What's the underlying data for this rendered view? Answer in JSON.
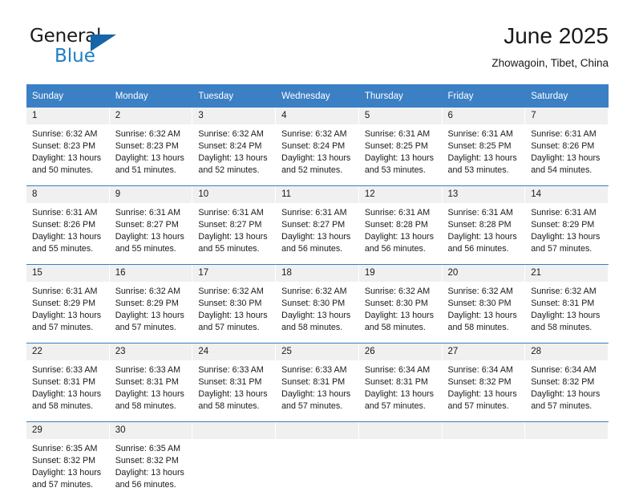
{
  "brand": {
    "name_top": "General",
    "name_bottom": "Blue",
    "accent_color": "#1d7ec4",
    "triangle_color": "#1565a8"
  },
  "header": {
    "title": "June 2025",
    "subtitle": "Zhowagoin, Tibet, China"
  },
  "theme": {
    "header_bg": "#3b7fc4",
    "daynum_bg": "#f0f0f0",
    "text": "#1a1a1a"
  },
  "weekday_headers": [
    "Sunday",
    "Monday",
    "Tuesday",
    "Wednesday",
    "Thursday",
    "Friday",
    "Saturday"
  ],
  "weeks": [
    [
      {
        "day": "1",
        "sunrise": "Sunrise: 6:32 AM",
        "sunset": "Sunset: 8:23 PM",
        "daylight": "Daylight: 13 hours and 50 minutes."
      },
      {
        "day": "2",
        "sunrise": "Sunrise: 6:32 AM",
        "sunset": "Sunset: 8:23 PM",
        "daylight": "Daylight: 13 hours and 51 minutes."
      },
      {
        "day": "3",
        "sunrise": "Sunrise: 6:32 AM",
        "sunset": "Sunset: 8:24 PM",
        "daylight": "Daylight: 13 hours and 52 minutes."
      },
      {
        "day": "4",
        "sunrise": "Sunrise: 6:32 AM",
        "sunset": "Sunset: 8:24 PM",
        "daylight": "Daylight: 13 hours and 52 minutes."
      },
      {
        "day": "5",
        "sunrise": "Sunrise: 6:31 AM",
        "sunset": "Sunset: 8:25 PM",
        "daylight": "Daylight: 13 hours and 53 minutes."
      },
      {
        "day": "6",
        "sunrise": "Sunrise: 6:31 AM",
        "sunset": "Sunset: 8:25 PM",
        "daylight": "Daylight: 13 hours and 53 minutes."
      },
      {
        "day": "7",
        "sunrise": "Sunrise: 6:31 AM",
        "sunset": "Sunset: 8:26 PM",
        "daylight": "Daylight: 13 hours and 54 minutes."
      }
    ],
    [
      {
        "day": "8",
        "sunrise": "Sunrise: 6:31 AM",
        "sunset": "Sunset: 8:26 PM",
        "daylight": "Daylight: 13 hours and 55 minutes."
      },
      {
        "day": "9",
        "sunrise": "Sunrise: 6:31 AM",
        "sunset": "Sunset: 8:27 PM",
        "daylight": "Daylight: 13 hours and 55 minutes."
      },
      {
        "day": "10",
        "sunrise": "Sunrise: 6:31 AM",
        "sunset": "Sunset: 8:27 PM",
        "daylight": "Daylight: 13 hours and 55 minutes."
      },
      {
        "day": "11",
        "sunrise": "Sunrise: 6:31 AM",
        "sunset": "Sunset: 8:27 PM",
        "daylight": "Daylight: 13 hours and 56 minutes."
      },
      {
        "day": "12",
        "sunrise": "Sunrise: 6:31 AM",
        "sunset": "Sunset: 8:28 PM",
        "daylight": "Daylight: 13 hours and 56 minutes."
      },
      {
        "day": "13",
        "sunrise": "Sunrise: 6:31 AM",
        "sunset": "Sunset: 8:28 PM",
        "daylight": "Daylight: 13 hours and 56 minutes."
      },
      {
        "day": "14",
        "sunrise": "Sunrise: 6:31 AM",
        "sunset": "Sunset: 8:29 PM",
        "daylight": "Daylight: 13 hours and 57 minutes."
      }
    ],
    [
      {
        "day": "15",
        "sunrise": "Sunrise: 6:31 AM",
        "sunset": "Sunset: 8:29 PM",
        "daylight": "Daylight: 13 hours and 57 minutes."
      },
      {
        "day": "16",
        "sunrise": "Sunrise: 6:32 AM",
        "sunset": "Sunset: 8:29 PM",
        "daylight": "Daylight: 13 hours and 57 minutes."
      },
      {
        "day": "17",
        "sunrise": "Sunrise: 6:32 AM",
        "sunset": "Sunset: 8:30 PM",
        "daylight": "Daylight: 13 hours and 57 minutes."
      },
      {
        "day": "18",
        "sunrise": "Sunrise: 6:32 AM",
        "sunset": "Sunset: 8:30 PM",
        "daylight": "Daylight: 13 hours and 58 minutes."
      },
      {
        "day": "19",
        "sunrise": "Sunrise: 6:32 AM",
        "sunset": "Sunset: 8:30 PM",
        "daylight": "Daylight: 13 hours and 58 minutes."
      },
      {
        "day": "20",
        "sunrise": "Sunrise: 6:32 AM",
        "sunset": "Sunset: 8:30 PM",
        "daylight": "Daylight: 13 hours and 58 minutes."
      },
      {
        "day": "21",
        "sunrise": "Sunrise: 6:32 AM",
        "sunset": "Sunset: 8:31 PM",
        "daylight": "Daylight: 13 hours and 58 minutes."
      }
    ],
    [
      {
        "day": "22",
        "sunrise": "Sunrise: 6:33 AM",
        "sunset": "Sunset: 8:31 PM",
        "daylight": "Daylight: 13 hours and 58 minutes."
      },
      {
        "day": "23",
        "sunrise": "Sunrise: 6:33 AM",
        "sunset": "Sunset: 8:31 PM",
        "daylight": "Daylight: 13 hours and 58 minutes."
      },
      {
        "day": "24",
        "sunrise": "Sunrise: 6:33 AM",
        "sunset": "Sunset: 8:31 PM",
        "daylight": "Daylight: 13 hours and 58 minutes."
      },
      {
        "day": "25",
        "sunrise": "Sunrise: 6:33 AM",
        "sunset": "Sunset: 8:31 PM",
        "daylight": "Daylight: 13 hours and 57 minutes."
      },
      {
        "day": "26",
        "sunrise": "Sunrise: 6:34 AM",
        "sunset": "Sunset: 8:31 PM",
        "daylight": "Daylight: 13 hours and 57 minutes."
      },
      {
        "day": "27",
        "sunrise": "Sunrise: 6:34 AM",
        "sunset": "Sunset: 8:32 PM",
        "daylight": "Daylight: 13 hours and 57 minutes."
      },
      {
        "day": "28",
        "sunrise": "Sunrise: 6:34 AM",
        "sunset": "Sunset: 8:32 PM",
        "daylight": "Daylight: 13 hours and 57 minutes."
      }
    ],
    [
      {
        "day": "29",
        "sunrise": "Sunrise: 6:35 AM",
        "sunset": "Sunset: 8:32 PM",
        "daylight": "Daylight: 13 hours and 57 minutes."
      },
      {
        "day": "30",
        "sunrise": "Sunrise: 6:35 AM",
        "sunset": "Sunset: 8:32 PM",
        "daylight": "Daylight: 13 hours and 56 minutes."
      },
      {
        "day": "",
        "sunrise": "",
        "sunset": "",
        "daylight": ""
      },
      {
        "day": "",
        "sunrise": "",
        "sunset": "",
        "daylight": ""
      },
      {
        "day": "",
        "sunrise": "",
        "sunset": "",
        "daylight": ""
      },
      {
        "day": "",
        "sunrise": "",
        "sunset": "",
        "daylight": ""
      },
      {
        "day": "",
        "sunrise": "",
        "sunset": "",
        "daylight": ""
      }
    ]
  ]
}
